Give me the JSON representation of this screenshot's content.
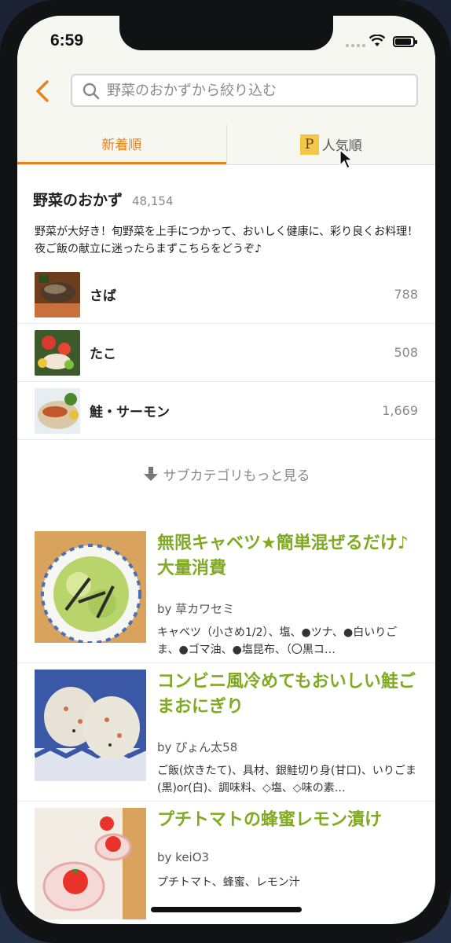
{
  "status_bar": {
    "time": "6:59"
  },
  "header": {
    "search_placeholder": "野菜のおかずから絞り込む"
  },
  "tabs": [
    {
      "label": "新着順"
    },
    {
      "label": "人気順",
      "premium_badge": "P"
    }
  ],
  "category": {
    "title": "野菜のおかず",
    "count": "48,154",
    "description": "野菜が大好き！旬野菜を上手につかって、おいしく健康に、彩り良くお料理！夜ご飯の献立に迷ったらまずこちらをどうぞ♪"
  },
  "subcategories": [
    {
      "name": "さば",
      "count": "788"
    },
    {
      "name": "たこ",
      "count": "508"
    },
    {
      "name": "鮭・サーモン",
      "count": "1,669"
    }
  ],
  "more_link": "サブカテゴリもっと見る",
  "recipes": [
    {
      "title": "無限キャベツ★簡単混ぜるだけ♪大量消費",
      "author": "by 草カワセミ",
      "ingredients": "キャベツ（小さめ1/2）、塩、●ツナ、●白いりごま、●ゴマ油、●塩昆布、（〇黒コ…"
    },
    {
      "title": "コンビニ風冷めてもおいしい鮭ごまおにぎり",
      "author": "by ぴょん太58",
      "ingredients": "ご飯(炊きたて)、具材、銀鮭切り身(甘口)、いりごま(黒)or(白)、調味料、◇塩、◇味の素…"
    },
    {
      "title": "プチトマトの蜂蜜レモン漬け",
      "author": "by keiO3",
      "ingredients": "プチトマト、蜂蜜、レモン汁"
    }
  ],
  "colors": {
    "accent": "#e8821e",
    "recipe_title": "#7faa22",
    "header_bg": "#f7f7f2"
  }
}
